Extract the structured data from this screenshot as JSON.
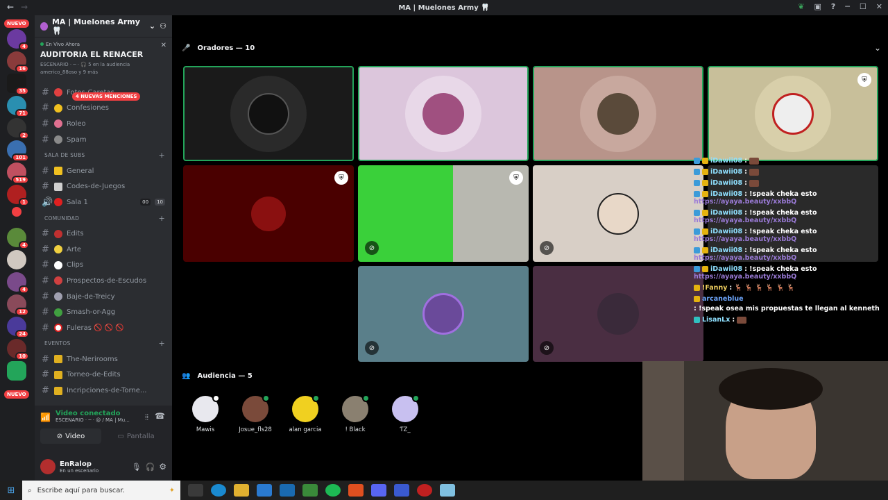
{
  "window": {
    "title": "MA | Muelones Army 🦷"
  },
  "servers": {
    "badges": [
      "4",
      "16",
      "35",
      "71",
      "2",
      "101",
      "519",
      "1",
      "4",
      "4",
      "12",
      "24",
      "10"
    ],
    "new_label_top": "NUEVO",
    "new_label_bottom": "NUEVO"
  },
  "guild": {
    "name": "MA | Muelones Army 🦷"
  },
  "stage": {
    "live_label": "En Vivo Ahora",
    "title": "AUDITORIA EL RENACER",
    "meta": "ESCENARIO · ─ · 🎧 5 en la audiencia",
    "attendees": "americo_88oso y 9 más"
  },
  "mentions_badge": "4 NUEVAS MENCIONES",
  "channels": [
    {
      "type": "channel",
      "label": "Fotos-Caretas"
    },
    {
      "type": "channel",
      "label": "Confesiones"
    },
    {
      "type": "channel",
      "label": "Roleo"
    },
    {
      "type": "channel",
      "label": "Spam"
    },
    {
      "type": "category",
      "label": "SALA DE SUBS"
    },
    {
      "type": "channel",
      "label": "General"
    },
    {
      "type": "channel",
      "label": "Codes-de-Juegos"
    },
    {
      "type": "voice",
      "label": "Sala 1",
      "count_a": "00",
      "count_b": "10"
    },
    {
      "type": "category",
      "label": "COMUNIDAD"
    },
    {
      "type": "channel",
      "label": "Edits"
    },
    {
      "type": "channel",
      "label": "Arte"
    },
    {
      "type": "channel",
      "label": "Clips"
    },
    {
      "type": "channel",
      "label": "Prospectos-de-Escudos"
    },
    {
      "type": "channel",
      "label": "Baje-de-Treicy"
    },
    {
      "type": "channel",
      "label": "Smash-or-Agg"
    },
    {
      "type": "channel",
      "label": "Fuleras 🚫 🚫 🚫"
    },
    {
      "type": "category",
      "label": "EVENTOS"
    },
    {
      "type": "channel",
      "label": "The-Nerirooms"
    },
    {
      "type": "channel",
      "label": "Torneo-de-Edits"
    },
    {
      "type": "channel",
      "label": "Incripciones-de-Torne..."
    }
  ],
  "voice": {
    "status": "Video conectado",
    "channel": "ESCENARIO · ─ · @ / MA | Mu...",
    "video_label": "Video",
    "screen_label": "Pantalla"
  },
  "user": {
    "name": "EnRalop",
    "status": "En un escenario"
  },
  "speakers": {
    "header": "Oradores — 10"
  },
  "audience": {
    "header": "Audiencia — 5",
    "members": [
      "Mawis",
      "Josue_fls28",
      "alan garcia",
      "! Black",
      "ƬZ_"
    ]
  },
  "chat": [
    {
      "user": "iDawii08",
      "msg": ":",
      "emote": true
    },
    {
      "user": "iDawii08",
      "msg": ":",
      "emote": true
    },
    {
      "user": "iDawii08",
      "msg": ":",
      "emote": true
    },
    {
      "user": "iDawii08",
      "msg": ": !speak cheka esto",
      "url": "https://ayaya.beauty/xxbbQ"
    },
    {
      "user": "iDawii08",
      "msg": ": !speak cheka esto",
      "url": "https://ayaya.beauty/xxbbQ"
    },
    {
      "user": "iDawii08",
      "msg": ": !speak cheka esto",
      "url": "https://ayaya.beauty/xxbbQ"
    },
    {
      "user": "iDawii08",
      "msg": ": !speak cheka esto",
      "url": "https://ayaya.beauty/xxbbQ"
    },
    {
      "user": "iDawii08",
      "msg": ": !speak cheka esto",
      "url": "https://ayaya.beauty/xxbbQ"
    },
    {
      "user": "!Fanny",
      "msg": ": 🦌 🦌 🦌 🦌 🦌 🦌"
    },
    {
      "user": "arcaneblue",
      "msg": ": !speak osea mis propuestas te llegan al kenneth"
    },
    {
      "user": "LisanLx",
      "msg": ":",
      "emote": true
    }
  ],
  "taskbar": {
    "search_placeholder": "Escribe aquí para buscar."
  }
}
